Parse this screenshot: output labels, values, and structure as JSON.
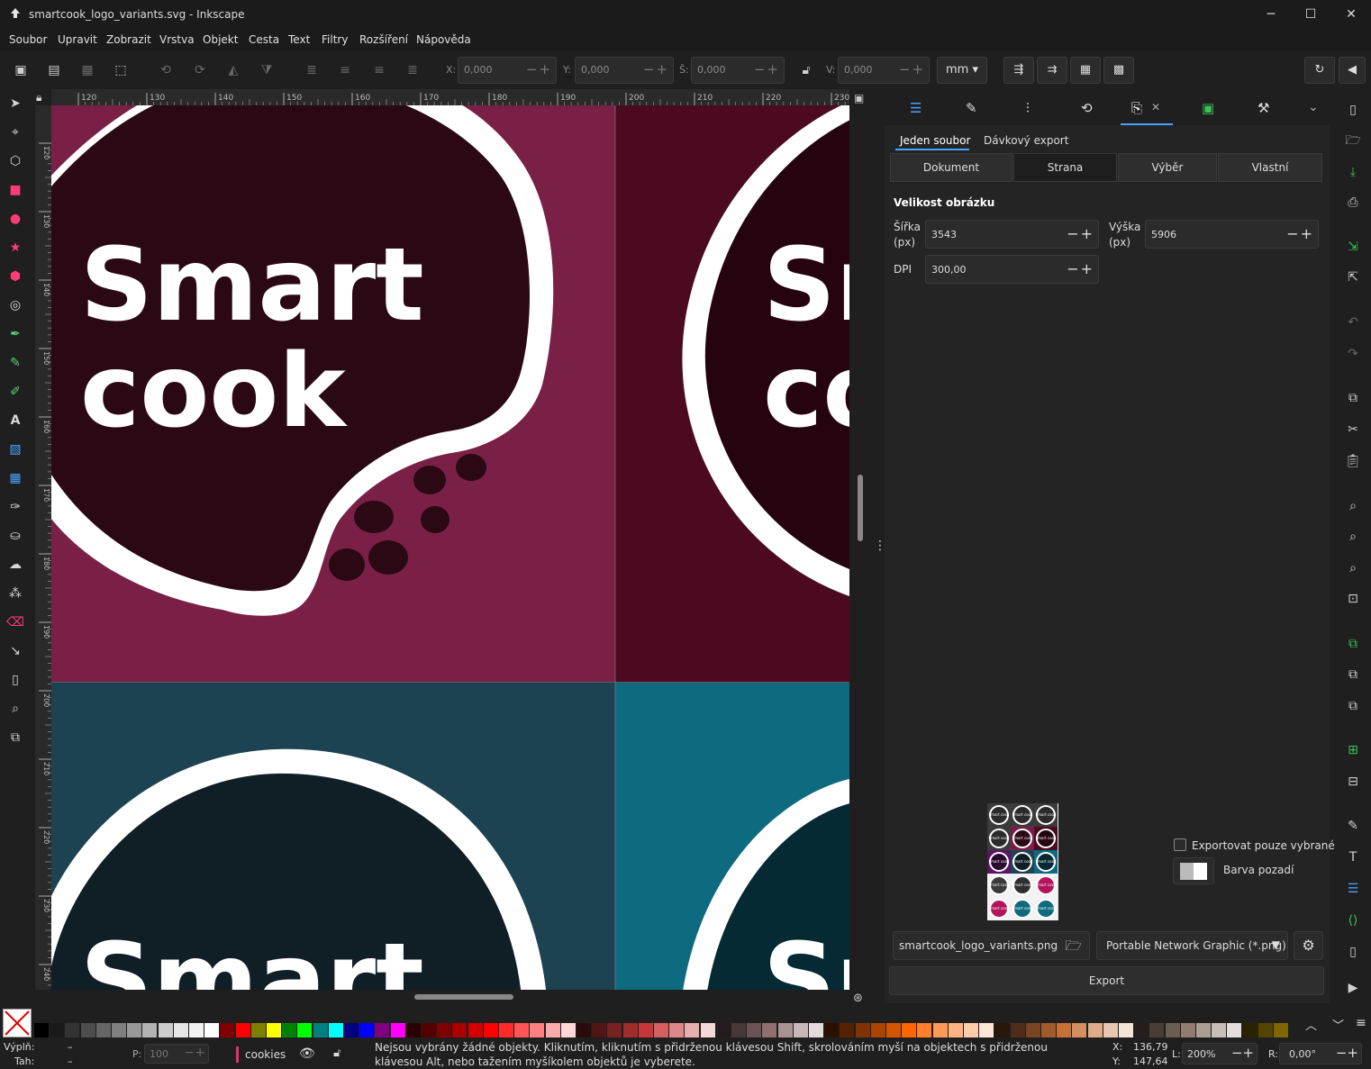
{
  "window": {
    "title": "smartcook_logo_variants.svg - Inkscape",
    "minimize": "─",
    "maximize": "☐",
    "close": "✕"
  },
  "menu": [
    "Soubor",
    "Upravit",
    "Zobrazit",
    "Vrstva",
    "Objekt",
    "Cesta",
    "Text",
    "Filtry",
    "Rozšíření",
    "Nápověda"
  ],
  "toolbar": {
    "x_label": "X:",
    "x_value": "0,000",
    "y_label": "Y:",
    "y_value": "0,000",
    "w_label": "Š:",
    "w_value": "0,000",
    "h_label": "V:",
    "h_value": "0,000",
    "unit": "mm"
  },
  "ruler": {
    "h_ticks": [
      "120",
      "130",
      "140",
      "150",
      "160",
      "170",
      "180",
      "190",
      "200",
      "210",
      "220",
      "230"
    ],
    "v_ticks": [
      "120",
      "130",
      "140",
      "150",
      "160",
      "170",
      "180",
      "190",
      "200",
      "210",
      "220",
      "230",
      "240"
    ]
  },
  "canvas": {
    "logo_line1": "Smart",
    "logo_line2": "cook",
    "tile_colors": [
      "#7a2047",
      "#4b0a20",
      "#1d4352",
      "#0e6a7e"
    ],
    "badge_colors": [
      "#2a0814",
      "#26040f",
      "#0f1f25",
      "#062a33"
    ]
  },
  "export": {
    "tabs": [
      "Jeden soubor",
      "Dávkový export"
    ],
    "modes": [
      "Dokument",
      "Strana",
      "Výběr",
      "Vlastní"
    ],
    "active_mode": "Strana",
    "section_title": "Velikost obrázku",
    "width_label_1": "Šířka",
    "width_label_2": "(px)",
    "width_value": "3543",
    "height_label_1": "Výška",
    "height_label_2": "(px)",
    "height_value": "5906",
    "dpi_label": "DPI",
    "dpi_value": "300,00",
    "export_selected_only": "Exportovat pouze vybrané",
    "background_label": "Barva pozadí",
    "filename": "smartcook_logo_variants.png",
    "format": "Portable Network Graphic (*.png)",
    "export_button": "Export",
    "preview_label": "Smart cook"
  },
  "palette": [
    "#000000",
    "#1a1a1a",
    "#333333",
    "#4d4d4d",
    "#666666",
    "#808080",
    "#999999",
    "#b3b3b3",
    "#cccccc",
    "#e6e6e6",
    "#f2f2f2",
    "#ffffff",
    "#800000",
    "#ff0000",
    "#808000",
    "#ffff00",
    "#008000",
    "#00ff00",
    "#008080",
    "#00ffff",
    "#000080",
    "#0000ff",
    "#800080",
    "#ff00ff",
    "#2b0000",
    "#550000",
    "#800000",
    "#aa0000",
    "#d40000",
    "#ff0000",
    "#ff2a2a",
    "#ff5555",
    "#ff8080",
    "#ffaaaa",
    "#ffd5d5",
    "#280b0b",
    "#501616",
    "#782121",
    "#a02c2c",
    "#c83737",
    "#d35f5f",
    "#de8787",
    "#e9afaf",
    "#f4d7d7",
    "#241c1c",
    "#483737",
    "#6c5353",
    "#916f6f",
    "#ac9393",
    "#c8b7b7",
    "#e3dbdb",
    "#2b1100",
    "#552200",
    "#803300",
    "#aa4400",
    "#d45500",
    "#ff6600",
    "#ff7f2a",
    "#ff9955",
    "#ffb380",
    "#ffccaa",
    "#ffe6d5",
    "#28170b",
    "#502d16",
    "#784421",
    "#a05a2c",
    "#c87137",
    "#d38d5f",
    "#deaa87",
    "#e9c6af",
    "#f4e3d7",
    "#241f1c",
    "#483e37",
    "#6c5d53",
    "#917c6f",
    "#ac9d93",
    "#c8beb7",
    "#e3dedb",
    "#2b2200",
    "#554400",
    "#806600"
  ],
  "status": {
    "fill_label": "Výplň:",
    "stroke_label": "Tah:",
    "fill_value": "–",
    "stroke_value": "–",
    "opacity_label": "P:",
    "opacity_value": "100",
    "layer": "cookies",
    "message": "Nejsou vybrány žádné objekty. Kliknutím, kliknutím s přidrženou klávesou Shift, skrolováním myší na objektech s přidrženou klávesou Alt, nebo tažením myšíkolem objektů je vyberete.",
    "x_label": "X:",
    "x_value": "136,79",
    "y_label": "Y:",
    "y_value": "147,64",
    "zoom_label": "L:",
    "zoom_value": "200%",
    "rotation_label": "R:",
    "rotation_value": "0,00°"
  }
}
